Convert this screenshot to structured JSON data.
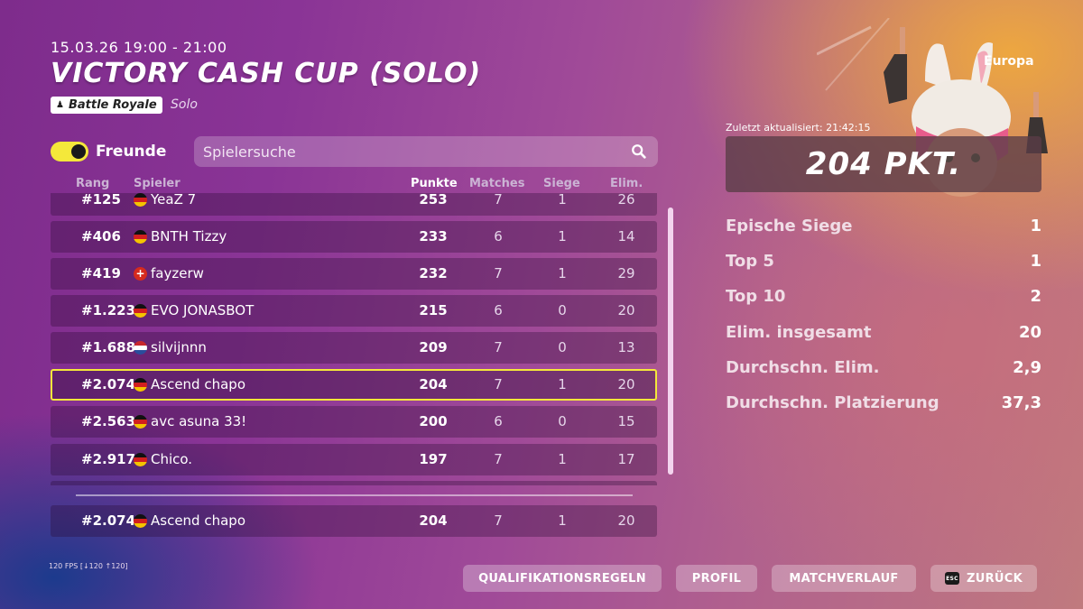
{
  "header": {
    "date": "15.03.26 19:00 - 21:00",
    "title": "VICTORY CASH CUP (SOLO)",
    "mode_badge": "Battle Royale",
    "mode_sub": "Solo"
  },
  "friends_toggle": {
    "label": "Freunde",
    "enabled": true
  },
  "search": {
    "placeholder": "Spielersuche"
  },
  "columns": {
    "rank": "Rang",
    "player": "Spieler",
    "points": "Punkte",
    "matches": "Matches",
    "wins": "Siege",
    "elims": "Elim."
  },
  "rows": [
    {
      "rank": "#125",
      "flag": "de",
      "name": "YeaZ 7",
      "points": "253",
      "matches": "7",
      "wins": "1",
      "elims": "26"
    },
    {
      "rank": "#406",
      "flag": "de",
      "name": "BNTH Tizzy",
      "points": "233",
      "matches": "6",
      "wins": "1",
      "elims": "14"
    },
    {
      "rank": "#419",
      "flag": "ch",
      "name": "fayzerw",
      "points": "232",
      "matches": "7",
      "wins": "1",
      "elims": "29"
    },
    {
      "rank": "#1.223",
      "flag": "de",
      "name": "EVO JONASBOT",
      "points": "215",
      "matches": "6",
      "wins": "0",
      "elims": "20"
    },
    {
      "rank": "#1.688",
      "flag": "nl",
      "name": "silvijnnn",
      "points": "209",
      "matches": "7",
      "wins": "0",
      "elims": "13"
    },
    {
      "rank": "#2.074",
      "flag": "de",
      "name": "Ascend chapo",
      "points": "204",
      "matches": "7",
      "wins": "1",
      "elims": "20"
    },
    {
      "rank": "#2.563",
      "flag": "de",
      "name": "avc asuna 33!",
      "points": "200",
      "matches": "6",
      "wins": "0",
      "elims": "15"
    },
    {
      "rank": "#2.917",
      "flag": "de",
      "name": "Chico.",
      "points": "197",
      "matches": "7",
      "wins": "1",
      "elims": "17"
    }
  ],
  "own_row": {
    "rank": "#2.074",
    "flag": "de",
    "name": "Ascend chapo",
    "points": "204",
    "matches": "7",
    "wins": "1",
    "elims": "20"
  },
  "summary": {
    "region": "Europa",
    "updated": "Zuletzt aktualisiert: 21:42:15",
    "score": "204 PKT.",
    "stats": [
      {
        "label": "Epische Siege",
        "value": "1"
      },
      {
        "label": "Top 5",
        "value": "1"
      },
      {
        "label": "Top 10",
        "value": "2"
      },
      {
        "label": "Elim. insgesamt",
        "value": "20"
      },
      {
        "label": "Durchschn. Elim.",
        "value": "2,9"
      },
      {
        "label": "Durchschn. Platzierung",
        "value": "37,3"
      }
    ]
  },
  "footer": {
    "fps": "120 FPS [↓120 ↑120]",
    "buttons": {
      "rules": "QUALIFIKATIONSREGELN",
      "profile": "PROFIL",
      "history": "MATCHVERLAUF",
      "back": "ZURÜCK",
      "back_key": "ESC"
    }
  },
  "colors": {
    "highlight": "#f4e83a",
    "accent": "#8a3496"
  }
}
